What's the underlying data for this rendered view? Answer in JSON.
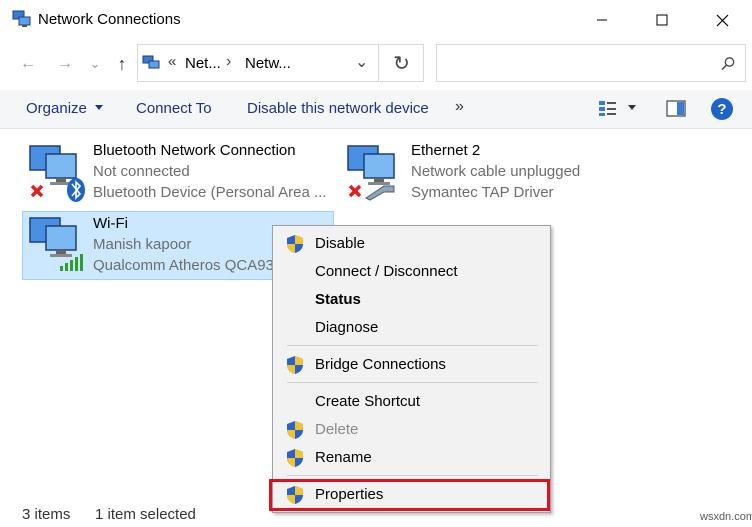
{
  "window": {
    "title": "Network Connections",
    "controls": {
      "minimize": "—",
      "maximize": "☐",
      "close": "✕"
    }
  },
  "address": {
    "back": "←",
    "forward": "→",
    "recent": "⌄",
    "up": "↑",
    "overflow": "«",
    "crumbs": [
      "Net...",
      "Netw..."
    ],
    "separator": "›",
    "dropdown": "⌄",
    "refresh": "↻",
    "search_placeholder": ""
  },
  "commands": {
    "organize": "Organize",
    "connect_to": "Connect To",
    "disable_device": "Disable this network device",
    "more": "»"
  },
  "connections": [
    {
      "name": "Bluetooth Network Connection",
      "status": "Not connected",
      "device": "Bluetooth Device (Personal Area ..."
    },
    {
      "name": "Ethernet 2",
      "status": "Network cable unplugged",
      "device": "Symantec TAP Driver"
    },
    {
      "name": "Wi-Fi",
      "status": "Manish kapoor",
      "device": "Qualcomm Atheros QCA93"
    }
  ],
  "context_menu": {
    "items": [
      {
        "label": "Disable",
        "shield": true,
        "style": "normal"
      },
      {
        "label": "Connect / Disconnect",
        "shield": false,
        "style": "normal"
      },
      {
        "label": "Status",
        "shield": false,
        "style": "bold"
      },
      {
        "label": "Diagnose",
        "shield": false,
        "style": "normal"
      },
      {
        "label": "Bridge Connections",
        "shield": true,
        "style": "normal"
      },
      {
        "label": "Create Shortcut",
        "shield": false,
        "style": "normal"
      },
      {
        "label": "Delete",
        "shield": true,
        "style": "disabled"
      },
      {
        "label": "Rename",
        "shield": true,
        "style": "normal"
      },
      {
        "label": "Properties",
        "shield": true,
        "style": "normal"
      }
    ]
  },
  "statusbar": {
    "item_count": "3 items",
    "selection": "1 item selected"
  },
  "watermark": "wsxdn.com",
  "colors": {
    "accent_text": "#1e3287",
    "selection_bg": "#cce8ff",
    "highlight_border": "#e0101e",
    "help_blue": "#1e63c6"
  }
}
